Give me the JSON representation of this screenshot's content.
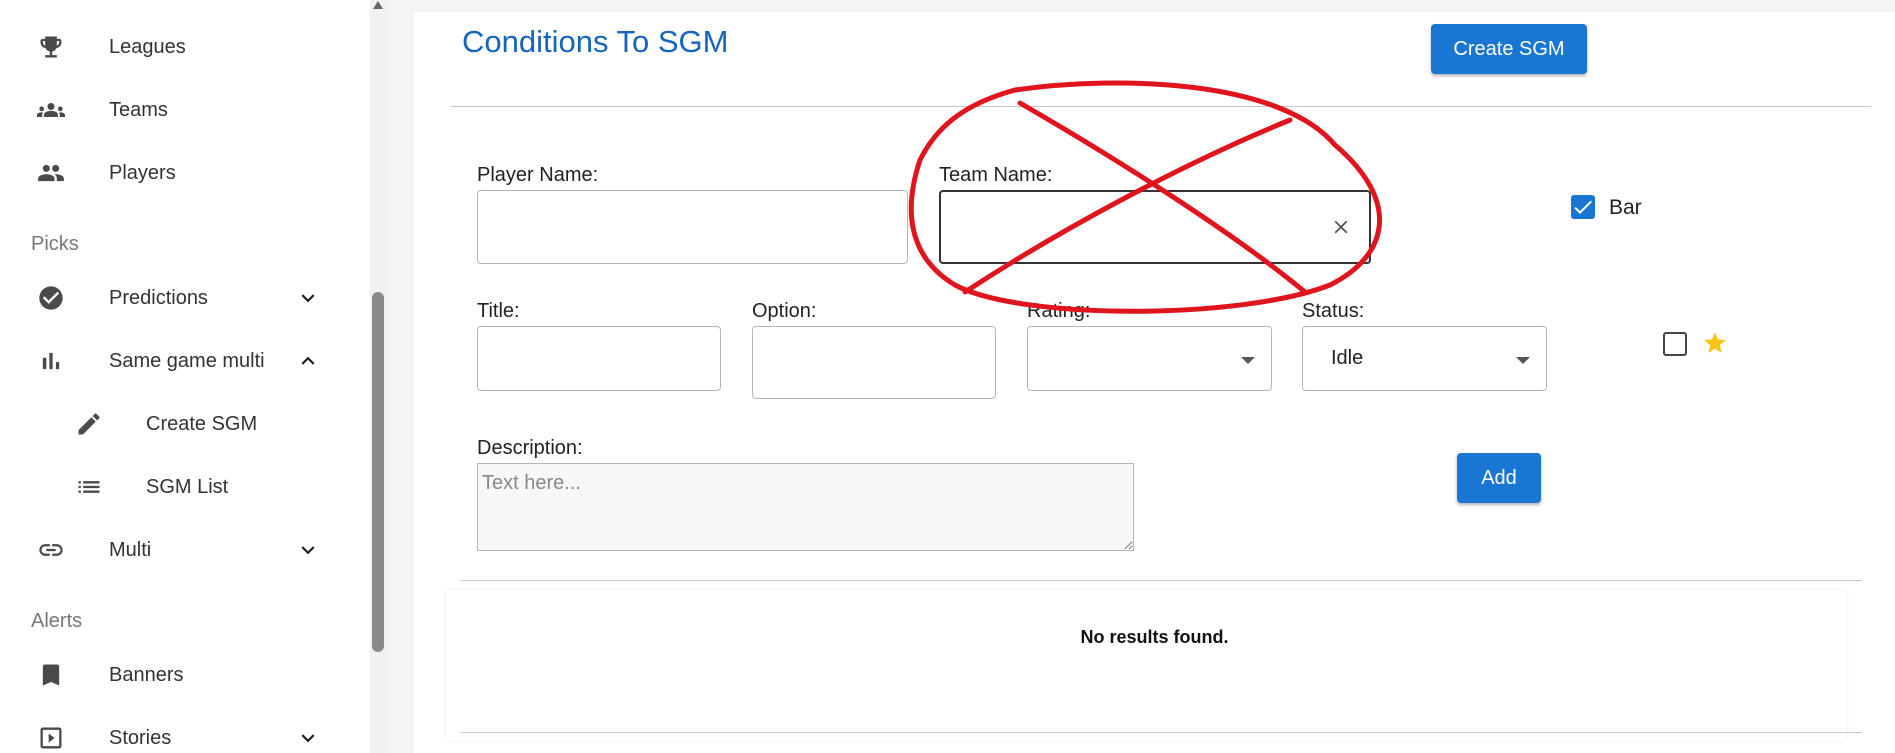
{
  "sidebar": {
    "items": [
      {
        "label": "Leagues",
        "icon": "trophy-icon"
      },
      {
        "label": "Teams",
        "icon": "groups-icon"
      },
      {
        "label": "Players",
        "icon": "people-icon"
      },
      {
        "label": "Predictions",
        "icon": "check-circle-icon"
      },
      {
        "label": "Same game multi",
        "icon": "bar-chart-icon"
      },
      {
        "label": "Create SGM",
        "icon": "pencil-icon"
      },
      {
        "label": "SGM List",
        "icon": "list-icon"
      },
      {
        "label": "Multi",
        "icon": "link-icon"
      },
      {
        "label": "Banners",
        "icon": "bookmark-icon"
      },
      {
        "label": "Stories",
        "icon": "slideshow-icon"
      }
    ],
    "sections": {
      "picks": "Picks",
      "alerts": "Alerts"
    }
  },
  "main": {
    "title": "Conditions To SGM",
    "create_button": "Create SGM",
    "form": {
      "player_label": "Player Name:",
      "player_value": "",
      "team_label": "Team Name:",
      "team_value": "",
      "title_label": "Title:",
      "option_label": "Option:",
      "rating_label": "Rating:",
      "rating_value": "",
      "status_label": "Status:",
      "status_value": "Idle",
      "description_label": "Description:",
      "description_placeholder": "Text here...",
      "bar_checkbox_label": "Bar",
      "bar_checked": true,
      "featured_checked": false,
      "add_button": "Add"
    },
    "results": {
      "empty_message": "No results found."
    }
  },
  "colors": {
    "accent": "#1976d2",
    "title": "#1565c0",
    "annotation": "#e0141c",
    "star": "#f5c518"
  }
}
